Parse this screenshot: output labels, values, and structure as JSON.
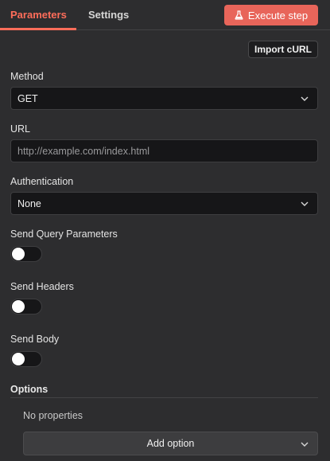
{
  "tabs": [
    {
      "label": "Parameters",
      "active": true
    },
    {
      "label": "Settings",
      "active": false
    }
  ],
  "execute_button": {
    "label": "Execute step",
    "icon": "flask-icon",
    "color": "#e8655a"
  },
  "import_button": {
    "label": "Import cURL"
  },
  "method": {
    "label": "Method",
    "value": "GET"
  },
  "url": {
    "label": "URL",
    "value": "",
    "placeholder": "http://example.com/index.html"
  },
  "authentication": {
    "label": "Authentication",
    "value": "None"
  },
  "toggles": [
    {
      "label": "Send Query Parameters",
      "on": false
    },
    {
      "label": "Send Headers",
      "on": false
    },
    {
      "label": "Send Body",
      "on": false
    }
  ],
  "options": {
    "title": "Options",
    "empty_text": "No properties",
    "add_label": "Add option"
  },
  "colors": {
    "accent": "#ff6d5a",
    "background": "#2d2d2f",
    "field_background": "#161618"
  }
}
